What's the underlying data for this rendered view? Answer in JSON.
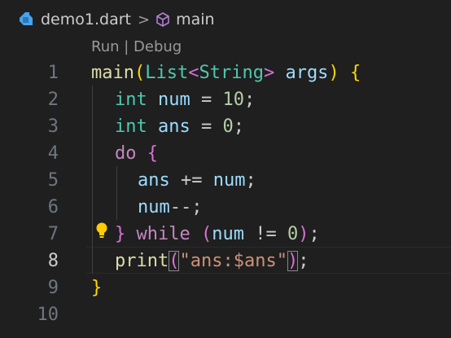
{
  "breadcrumb": {
    "file": "demo1.dart",
    "separator": ">",
    "symbol": "main"
  },
  "codelens": {
    "run": "Run",
    "divider": " | ",
    "debug": "Debug"
  },
  "editor": {
    "active_line": 8,
    "line_numbers": [
      "1",
      "2",
      "3",
      "4",
      "5",
      "6",
      "7",
      "8",
      "9",
      "10"
    ],
    "tokens": {
      "l1": [
        "main",
        "(",
        "List",
        "<",
        "String",
        ">",
        " args",
        ")",
        " ",
        "{"
      ],
      "l2": [
        "int",
        " num",
        " = ",
        "10",
        ";"
      ],
      "l3": [
        "int",
        " ans",
        " = ",
        "0",
        ";"
      ],
      "l4": [
        "do",
        " ",
        "{"
      ],
      "l5": [
        "ans",
        " += ",
        "num",
        ";"
      ],
      "l6": [
        "num",
        "--;"
      ],
      "l7": [
        "}",
        " ",
        "while",
        " ",
        "(",
        "num",
        " != ",
        "0",
        ")",
        ";"
      ],
      "l8": [
        "print",
        "(",
        "\"ans:$ans\"",
        ")",
        ";"
      ],
      "l9": [
        "}"
      ]
    }
  },
  "icons": {
    "breadcrumb_file": "dart-icon",
    "breadcrumb_symbol": "cube-icon",
    "quick_fix": "lightbulb-icon"
  }
}
